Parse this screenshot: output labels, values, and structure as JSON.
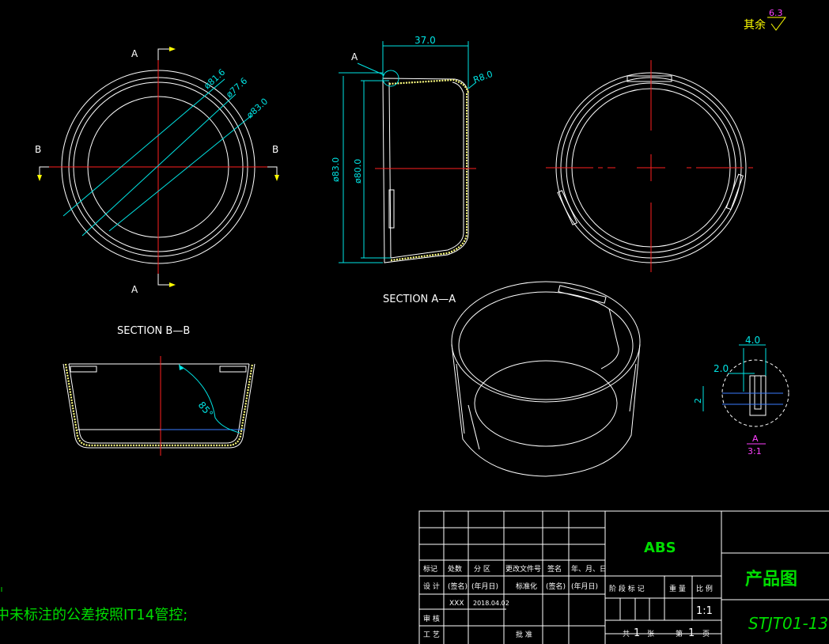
{
  "roughness": {
    "label": "其余",
    "value": "6.3"
  },
  "section_markers": {
    "a_top": "A",
    "a_bottom": "A",
    "b_left": "B",
    "b_right": "B"
  },
  "front_dims": {
    "d1": "ø81.6",
    "d2": "ø77.6",
    "d3": "ø83.0"
  },
  "section_aa": {
    "title": "SECTION A—A",
    "width": "37.0",
    "radius": "R8.0",
    "detail_ref": "A",
    "outer_dia": "ø83.0",
    "inner_dia": "ø80.0"
  },
  "section_bb": {
    "title": "SECTION B—B",
    "angle": "85°"
  },
  "detail_a": {
    "dim_top": "4.0",
    "dim_left": "2.0",
    "dim_side": "2",
    "label": "A",
    "scale": "3:1"
  },
  "note": "中未标注的公差按照IT14管控;",
  "title_block": {
    "material": "ABS",
    "drawing_name": "产品图",
    "drawing_number": "STJT01-13",
    "row_labels": [
      "标记",
      "处数",
      "分 区",
      "更改文件号",
      "签名",
      "年、月、日"
    ],
    "design_row": [
      "设 计",
      "(签名)",
      "(年月日)",
      "标准化",
      "(签名)",
      "(年月日)"
    ],
    "designer": "XXX",
    "date": "2018.04.02",
    "review": "审 核",
    "process": "工 艺",
    "approve": "批 准",
    "stage_labels": [
      "阶 段 标 记",
      "重 量",
      "比 例"
    ],
    "scale": "1:1",
    "sheets": {
      "total_prefix": "共",
      "total": "1",
      "total_suffix": "张",
      "page_prefix": "第",
      "page": "1",
      "page_suffix": "页"
    }
  }
}
